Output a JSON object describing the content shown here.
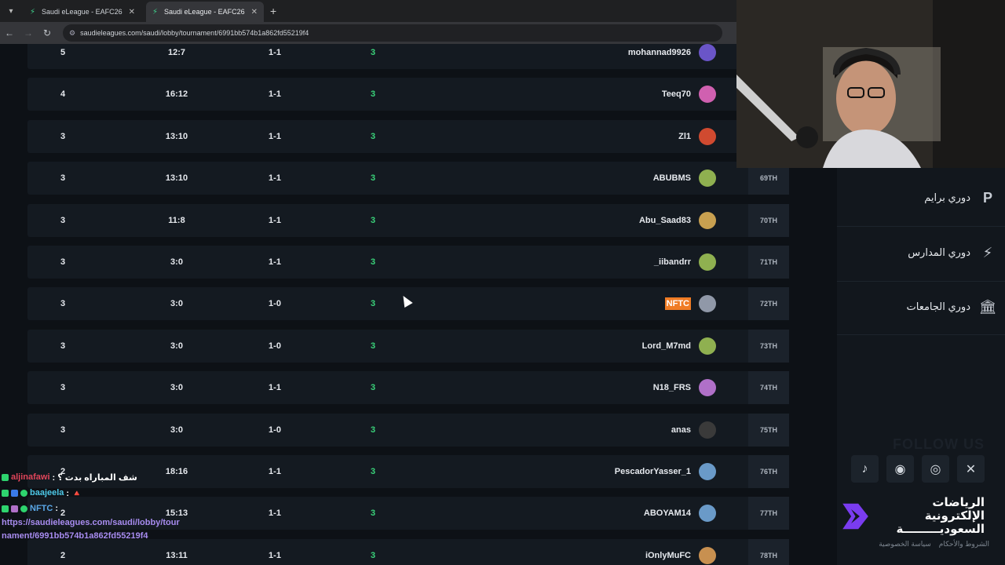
{
  "browser": {
    "tabs": [
      {
        "title": "Saudi eLeague - EAFC26",
        "active": false
      },
      {
        "title": "Saudi eLeague - EAFC26",
        "active": true
      }
    ],
    "new_tab": "+",
    "url": "saudieleagues.com/saudi/lobby/tournament/6991bb574b1a862fd55219f4"
  },
  "rows": [
    {
      "pts": "5",
      "goals": "12:7",
      "wl": "1-1",
      "played": "3",
      "name": "mohannad9926",
      "rank": "",
      "avatar_color": "#6a55c8"
    },
    {
      "pts": "4",
      "goals": "16:12",
      "wl": "1-1",
      "played": "3",
      "name": "Teeq70",
      "rank": "",
      "avatar_color": "#d060b0"
    },
    {
      "pts": "3",
      "goals": "13:10",
      "wl": "1-1",
      "played": "3",
      "name": "Zl1",
      "rank": "",
      "avatar_color": "#d04a30"
    },
    {
      "pts": "3",
      "goals": "13:10",
      "wl": "1-1",
      "played": "3",
      "name": "ABUBMS",
      "rank": "69TH",
      "avatar_color": "#8fb050"
    },
    {
      "pts": "3",
      "goals": "11:8",
      "wl": "1-1",
      "played": "3",
      "name": "Abu_Saad83",
      "rank": "70TH",
      "avatar_color": "#c8a050"
    },
    {
      "pts": "3",
      "goals": "3:0",
      "wl": "1-1",
      "played": "3",
      "name": "_iibandrr",
      "rank": "71TH",
      "avatar_color": "#8fb050"
    },
    {
      "pts": "3",
      "goals": "3:0",
      "wl": "1-0",
      "played": "3",
      "name": "NFTC",
      "rank": "72TH",
      "avatar_color": "#9098a8",
      "highlight": true
    },
    {
      "pts": "3",
      "goals": "3:0",
      "wl": "1-0",
      "played": "3",
      "name": "Lord_M7md",
      "rank": "73TH",
      "avatar_color": "#8fb050"
    },
    {
      "pts": "3",
      "goals": "3:0",
      "wl": "1-1",
      "played": "3",
      "name": "N18_FRS",
      "rank": "74TH",
      "avatar_color": "#b070c8"
    },
    {
      "pts": "3",
      "goals": "3:0",
      "wl": "1-0",
      "played": "3",
      "name": "anas",
      "rank": "75TH",
      "avatar_color": "#3a3a3a"
    },
    {
      "pts": "2",
      "goals": "18:16",
      "wl": "1-1",
      "played": "3",
      "name": "PescadorYasser_1",
      "rank": "76TH",
      "avatar_color": "#6a9ac8"
    },
    {
      "pts": "2",
      "goals": "15:13",
      "wl": "1-1",
      "played": "3",
      "name": "ABOYAM14",
      "rank": "77TH",
      "avatar_color": "#6a9ac8"
    },
    {
      "pts": "2",
      "goals": "13:11",
      "wl": "1-1",
      "played": "3",
      "name": "iOnlyMuFC",
      "rank": "78TH",
      "avatar_color": "#c89050"
    }
  ],
  "sidebar": {
    "items": [
      {
        "label": "دوري برايم",
        "icon": "prime-league-icon",
        "glyph": "P"
      },
      {
        "label": "دوري المدارس",
        "icon": "lightning-icon",
        "glyph": "⚡"
      },
      {
        "label": "دوري الجامعات",
        "icon": "university-icon",
        "glyph": "🏛"
      }
    ],
    "follow_text": "FOLLOW US",
    "socials": [
      {
        "icon": "tiktok-icon",
        "glyph": "♪"
      },
      {
        "icon": "discord-icon",
        "glyph": "◉"
      },
      {
        "icon": "instagram-icon",
        "glyph": "◎"
      },
      {
        "icon": "x-icon",
        "glyph": "✕"
      }
    ],
    "brand_line1": "الرياضات الإلكترونية",
    "brand_line2": "السعوديـــــــــة",
    "footer_terms": "الشروط والأحكام",
    "footer_privacy": "سياسة الخصوصية"
  },
  "chat": {
    "messages": [
      {
        "user": "aljinafawi",
        "user_color": "#e0455a",
        "text": ": شف المباراه بدت ؟"
      },
      {
        "user": "baajeela",
        "user_color": "#4ec9e8",
        "text": ": 🔺"
      },
      {
        "user": "NFTC",
        "user_color": "#5aa8e8",
        "text": ":"
      }
    ],
    "link": "https://saudieleagues.com/saudi/lobby/tournament/6991bb574b1a862fd55219f4"
  }
}
